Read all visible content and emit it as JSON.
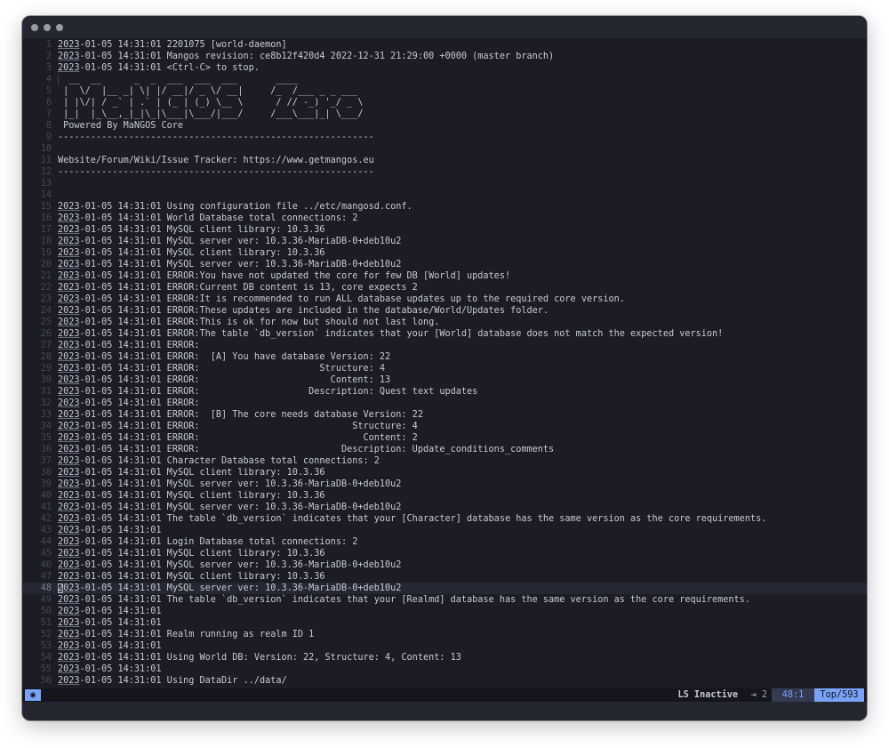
{
  "window": {
    "controls": [
      "close",
      "minimize",
      "maximize"
    ]
  },
  "editor": {
    "current_line": 48,
    "lines": [
      "2023-01-05 14:31:01 2201075 [world-daemon]",
      "2023-01-05 14:31:01 Mangos revision: ce8b12f420d4 2022-12-31 21:29:00 +0000 (master branch)",
      "2023-01-05 14:31:01 <Ctrl-C> to stop.",
      "  __  __      _  _  ___  ___  ___       ____",
      " |  \\/  |__ _| \\| |/ __|/ _ \\/ __|     /_  /___ _ _ ___",
      " | |\\/| / _` | .` | (_ | (_) \\__ \\      / // -_) '_/ _ \\",
      " |_|  |_\\__,_|_|\\_|\\___|\\___/|___/     /___\\___|_| \\___/",
      " Powered By MaNGOS Core",
      "----------------------------------------------------------",
      "",
      "Website/Forum/Wiki/Issue Tracker: https://www.getmangos.eu",
      "----------------------------------------------------------",
      "",
      "",
      "2023-01-05 14:31:01 Using configuration file ../etc/mangosd.conf.",
      "2023-01-05 14:31:01 World Database total connections: 2",
      "2023-01-05 14:31:01 MySQL client library: 10.3.36",
      "2023-01-05 14:31:01 MySQL server ver: 10.3.36-MariaDB-0+deb10u2",
      "2023-01-05 14:31:01 MySQL client library: 10.3.36",
      "2023-01-05 14:31:01 MySQL server ver: 10.3.36-MariaDB-0+deb10u2",
      "2023-01-05 14:31:01 ERROR:You have not updated the core for few DB [World] updates!",
      "2023-01-05 14:31:01 ERROR:Current DB content is 13, core expects 2",
      "2023-01-05 14:31:01 ERROR:It is recommended to run ALL database updates up to the required core version.",
      "2023-01-05 14:31:01 ERROR:These updates are included in the database/World/Updates folder.",
      "2023-01-05 14:31:01 ERROR:This is ok for now but should not last long.",
      "2023-01-05 14:31:01 ERROR:The table `db_version` indicates that your [World] database does not match the expected version!",
      "2023-01-05 14:31:01 ERROR:",
      "2023-01-05 14:31:01 ERROR:  [A] You have database Version: 22",
      "2023-01-05 14:31:01 ERROR:                      Structure: 4",
      "2023-01-05 14:31:01 ERROR:                        Content: 13",
      "2023-01-05 14:31:01 ERROR:                    Description: Quest text updates",
      "2023-01-05 14:31:01 ERROR:",
      "2023-01-05 14:31:01 ERROR:  [B] The core needs database Version: 22",
      "2023-01-05 14:31:01 ERROR:                            Structure: 4",
      "2023-01-05 14:31:01 ERROR:                              Content: 2",
      "2023-01-05 14:31:01 ERROR:                          Description: Update_conditions_comments",
      "2023-01-05 14:31:01 Character Database total connections: 2",
      "2023-01-05 14:31:01 MySQL client library: 10.3.36",
      "2023-01-05 14:31:01 MySQL server ver: 10.3.36-MariaDB-0+deb10u2",
      "2023-01-05 14:31:01 MySQL client library: 10.3.36",
      "2023-01-05 14:31:01 MySQL server ver: 10.3.36-MariaDB-0+deb10u2",
      "2023-01-05 14:31:01 The table `db_version` indicates that your [Character] database has the same version as the core requirements.",
      "2023-01-05 14:31:01",
      "2023-01-05 14:31:01 Login Database total connections: 2",
      "2023-01-05 14:31:01 MySQL client library: 10.3.36",
      "2023-01-05 14:31:01 MySQL server ver: 10.3.36-MariaDB-0+deb10u2",
      "2023-01-05 14:31:01 MySQL client library: 10.3.36",
      "2023-01-05 14:31:01 MySQL server ver: 10.3.36-MariaDB-0+deb10u2",
      "2023-01-05 14:31:01 The table `db_version` indicates that your [Realmd] database has the same version as the core requirements.",
      "2023-01-05 14:31:01",
      "2023-01-05 14:31:01",
      "2023-01-05 14:31:01 Realm running as realm ID 1",
      "2023-01-05 14:31:01",
      "2023-01-05 14:31:01 Using World DB: Version: 22, Structure: 4, Content: 13",
      "2023-01-05 14:31:01",
      "2023-01-05 14:31:01 Using DataDir ../data/"
    ]
  },
  "statusbar": {
    "mode_icon": "◉",
    "ls_status": "LS Inactive",
    "indent": "⇥ 2",
    "position": "48:1",
    "scroll": "Top/593"
  },
  "colors": {
    "accent": "#7aa2f7",
    "background": "#1b1c24",
    "foreground": "#c8cad3"
  }
}
